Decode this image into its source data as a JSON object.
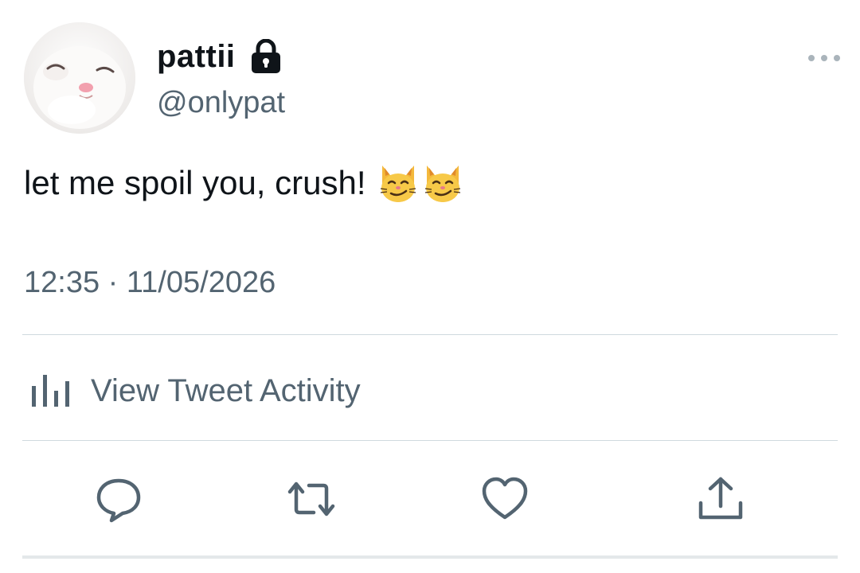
{
  "user": {
    "display_name": "pattii",
    "handle": "@onlypat",
    "avatar_icon": "cat-avatar",
    "locked_icon": "lock-icon"
  },
  "tweet": {
    "text": "let me spoil you, crush!",
    "emojis": [
      "smirking-cat-emoji",
      "smirking-cat-emoji"
    ],
    "timestamp": "12:35 · 11/05/2026"
  },
  "activity": {
    "label": "View Tweet Activity",
    "icon": "bar-chart-icon"
  },
  "actions": [
    {
      "name": "reply",
      "icon": "reply-icon"
    },
    {
      "name": "retweet",
      "icon": "retweet-icon"
    },
    {
      "name": "like",
      "icon": "heart-icon"
    },
    {
      "name": "share",
      "icon": "share-icon"
    }
  ],
  "colors": {
    "text_primary": "#0f1419",
    "text_secondary": "#536471",
    "divider": "#cfd9de"
  }
}
